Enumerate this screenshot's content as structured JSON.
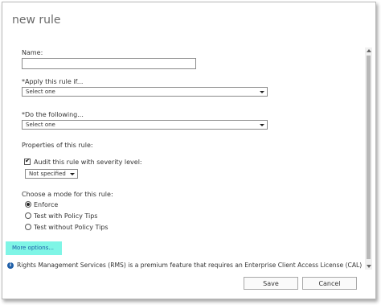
{
  "dialog": {
    "title": "new rule"
  },
  "form": {
    "name_label": "Name:",
    "name_value": "",
    "apply_label": "*Apply this rule if...",
    "apply_value": "Select one",
    "do_label": "*Do the following...",
    "do_value": "Select one",
    "properties_label": "Properties of this rule:",
    "audit_label": "Audit this rule with severity level:",
    "audit_checked": true,
    "severity_value": "Not specified",
    "mode_label": "Choose a mode for this rule:",
    "modes": [
      {
        "label": "Enforce",
        "selected": true
      },
      {
        "label": "Test with Policy Tips",
        "selected": false
      },
      {
        "label": "Test without Policy Tips",
        "selected": false
      }
    ],
    "more_options": "More options..."
  },
  "notice": {
    "icon": "info-icon",
    "text": "Rights Management Services (RMS) is a premium feature that requires an Enterprise Client Access License (CAL) or a RMS"
  },
  "footer": {
    "save_label": "Save",
    "cancel_label": "Cancel"
  },
  "colors": {
    "highlight": "#7ff5e6",
    "link": "#1d5da8"
  }
}
